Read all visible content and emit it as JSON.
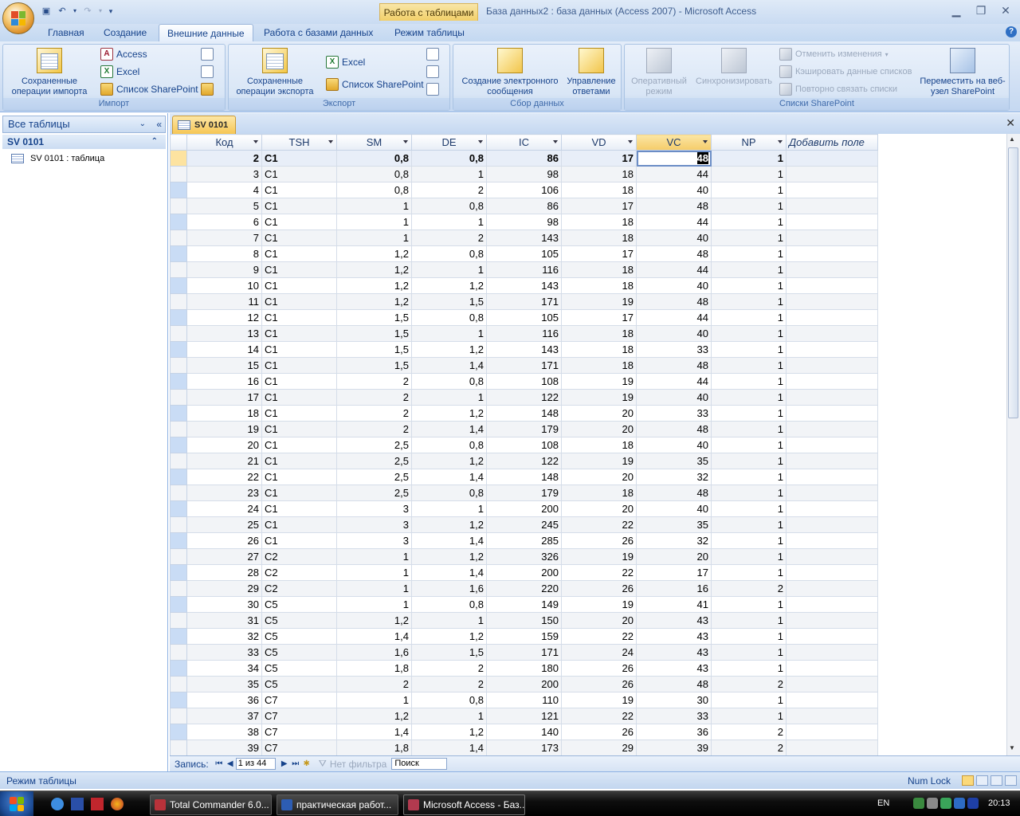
{
  "window": {
    "context_label": "Работа с таблицами",
    "title": "База данных2 : база данных (Access 2007) - Microsoft Access"
  },
  "ribbon_tabs": [
    {
      "label": "Главная",
      "active": false
    },
    {
      "label": "Создание",
      "active": false
    },
    {
      "label": "Внешние данные",
      "active": true
    },
    {
      "label": "Работа с базами данных",
      "active": false
    },
    {
      "label": "Режим таблицы",
      "active": false
    }
  ],
  "ribbon": {
    "import": {
      "label": "Импорт",
      "saved_imports": "Сохраненные операции импорта",
      "access": "Access",
      "excel": "Excel",
      "sharepoint_list": "Список SharePoint"
    },
    "export": {
      "label": "Экспорт",
      "saved_exports": "Сохраненные операции экспорта",
      "excel": "Excel",
      "sharepoint_list": "Список SharePoint"
    },
    "collect": {
      "label": "Сбор данных",
      "create_email": "Создание электронного сообщения",
      "manage_replies": "Управление ответами"
    },
    "sharepoint": {
      "label": "Списки SharePoint",
      "work_online": "Оперативный режим",
      "synchronize": "Синхронизировать",
      "discard_changes": "Отменить изменения",
      "cache_list_data": "Кэшировать данные списков",
      "relink_lists": "Повторно связать списки",
      "move_to_sharepoint": "Переместить на веб-узел SharePoint"
    }
  },
  "nav_pane": {
    "header": "Все таблицы",
    "group": "SV 0101",
    "item": "SV 0101 : таблица"
  },
  "doc_tab": "SV 0101",
  "table": {
    "columns": [
      "Код",
      "TSH",
      "SM",
      "DE",
      "IC",
      "VD",
      "VC",
      "NP"
    ],
    "add_field": "Добавить поле",
    "rows": [
      [
        "2",
        "C1",
        "0,8",
        "0,8",
        "86",
        "17",
        "48",
        "1"
      ],
      [
        "3",
        "C1",
        "0,8",
        "1",
        "98",
        "18",
        "44",
        "1"
      ],
      [
        "4",
        "C1",
        "0,8",
        "2",
        "106",
        "18",
        "40",
        "1"
      ],
      [
        "5",
        "C1",
        "1",
        "0,8",
        "86",
        "17",
        "48",
        "1"
      ],
      [
        "6",
        "C1",
        "1",
        "1",
        "98",
        "18",
        "44",
        "1"
      ],
      [
        "7",
        "C1",
        "1",
        "2",
        "143",
        "18",
        "40",
        "1"
      ],
      [
        "8",
        "C1",
        "1,2",
        "0,8",
        "105",
        "17",
        "48",
        "1"
      ],
      [
        "9",
        "C1",
        "1,2",
        "1",
        "116",
        "18",
        "44",
        "1"
      ],
      [
        "10",
        "C1",
        "1,2",
        "1,2",
        "143",
        "18",
        "40",
        "1"
      ],
      [
        "11",
        "C1",
        "1,2",
        "1,5",
        "171",
        "19",
        "48",
        "1"
      ],
      [
        "12",
        "C1",
        "1,5",
        "0,8",
        "105",
        "17",
        "44",
        "1"
      ],
      [
        "13",
        "C1",
        "1,5",
        "1",
        "116",
        "18",
        "40",
        "1"
      ],
      [
        "14",
        "C1",
        "1,5",
        "1,2",
        "143",
        "18",
        "33",
        "1"
      ],
      [
        "15",
        "C1",
        "1,5",
        "1,4",
        "171",
        "18",
        "48",
        "1"
      ],
      [
        "16",
        "C1",
        "2",
        "0,8",
        "108",
        "19",
        "44",
        "1"
      ],
      [
        "17",
        "C1",
        "2",
        "1",
        "122",
        "19",
        "40",
        "1"
      ],
      [
        "18",
        "C1",
        "2",
        "1,2",
        "148",
        "20",
        "33",
        "1"
      ],
      [
        "19",
        "C1",
        "2",
        "1,4",
        "179",
        "20",
        "48",
        "1"
      ],
      [
        "20",
        "C1",
        "2,5",
        "0,8",
        "108",
        "18",
        "40",
        "1"
      ],
      [
        "21",
        "C1",
        "2,5",
        "1,2",
        "122",
        "19",
        "35",
        "1"
      ],
      [
        "22",
        "C1",
        "2,5",
        "1,4",
        "148",
        "20",
        "32",
        "1"
      ],
      [
        "23",
        "C1",
        "2,5",
        "0,8",
        "179",
        "18",
        "48",
        "1"
      ],
      [
        "24",
        "C1",
        "3",
        "1",
        "200",
        "20",
        "40",
        "1"
      ],
      [
        "25",
        "C1",
        "3",
        "1,2",
        "245",
        "22",
        "35",
        "1"
      ],
      [
        "26",
        "C1",
        "3",
        "1,4",
        "285",
        "26",
        "32",
        "1"
      ],
      [
        "27",
        "C2",
        "1",
        "1,2",
        "326",
        "19",
        "20",
        "1"
      ],
      [
        "28",
        "C2",
        "1",
        "1,4",
        "200",
        "22",
        "17",
        "1"
      ],
      [
        "29",
        "C2",
        "1",
        "1,6",
        "220",
        "26",
        "16",
        "2"
      ],
      [
        "30",
        "C5",
        "1",
        "0,8",
        "149",
        "19",
        "41",
        "1"
      ],
      [
        "31",
        "C5",
        "1,2",
        "1",
        "150",
        "20",
        "43",
        "1"
      ],
      [
        "32",
        "C5",
        "1,4",
        "1,2",
        "159",
        "22",
        "43",
        "1"
      ],
      [
        "33",
        "C5",
        "1,6",
        "1,5",
        "171",
        "24",
        "43",
        "1"
      ],
      [
        "34",
        "C5",
        "1,8",
        "2",
        "180",
        "26",
        "43",
        "1"
      ],
      [
        "35",
        "C5",
        "2",
        "2",
        "200",
        "26",
        "48",
        "2"
      ],
      [
        "36",
        "C7",
        "1",
        "0,8",
        "110",
        "19",
        "30",
        "1"
      ],
      [
        "37",
        "C7",
        "1,2",
        "1",
        "121",
        "22",
        "33",
        "1"
      ],
      [
        "38",
        "C7",
        "1,4",
        "1,2",
        "140",
        "26",
        "36",
        "2"
      ],
      [
        "39",
        "C7",
        "1,8",
        "1,4",
        "173",
        "29",
        "39",
        "2"
      ]
    ]
  },
  "record_nav": {
    "label": "Запись:",
    "current": "1 из 44",
    "filter": "Нет фильтра",
    "search": "Поиск"
  },
  "status": {
    "mode": "Режим таблицы",
    "numlock": "Num Lock"
  },
  "taskbar": {
    "items": [
      "Total Commander 6.0...",
      "практическая работ...",
      "Microsoft Access - Баз..."
    ],
    "lang": "EN",
    "clock": "20:13"
  }
}
